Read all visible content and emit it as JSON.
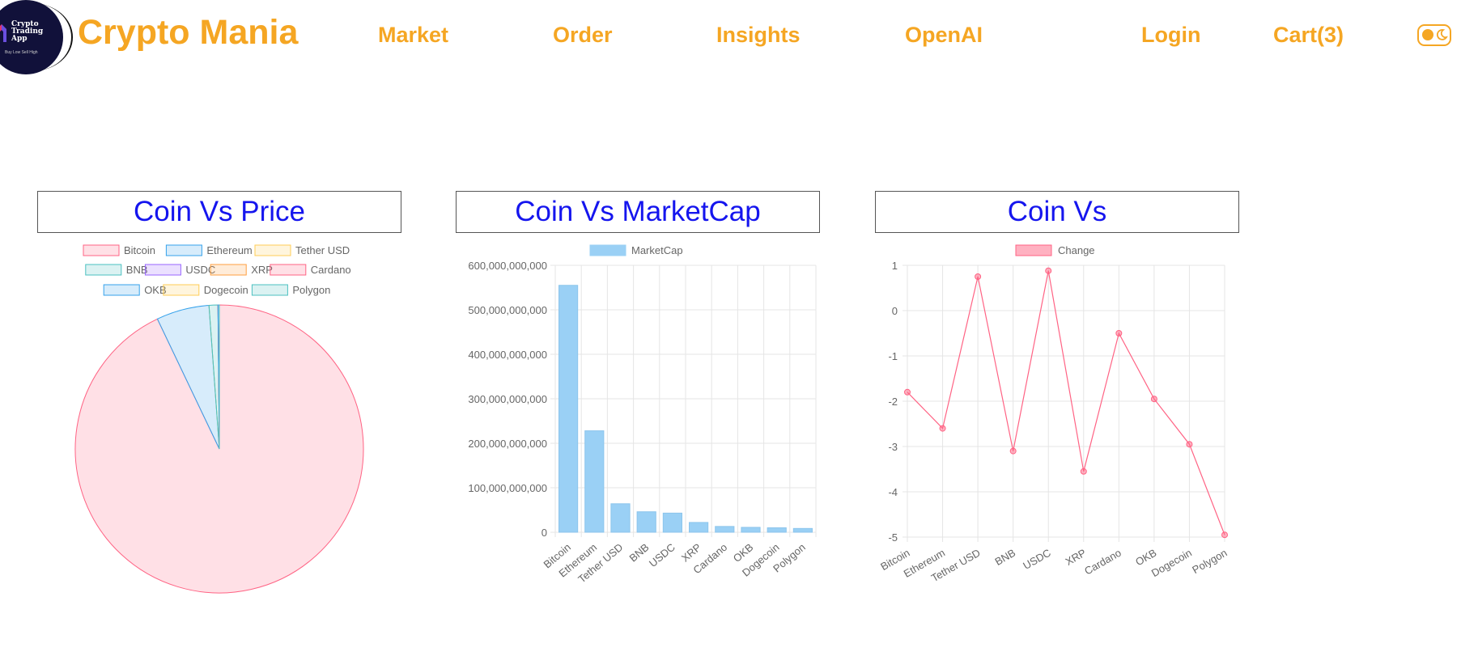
{
  "logo": {
    "line1": "Crypto",
    "line2": "Trading",
    "line3": "App",
    "tagline": "Buy Low Sell High"
  },
  "brand": "Crypto Mania",
  "nav": {
    "market": "Market",
    "order": "Order",
    "insights": "Insights",
    "openai": "OpenAI",
    "login": "Login",
    "cart": "Cart(3)",
    "theme_toggle_icon": "moon-icon"
  },
  "colors": {
    "accent": "#f5a623",
    "title": "#1515ee"
  },
  "titles": {
    "price": "Coin Vs Price",
    "marketcap": "Coin Vs MarketCap",
    "change": "Coin Vs"
  },
  "chart_data": [
    {
      "type": "pie",
      "title": "Coin Vs Price",
      "categories": [
        "Bitcoin",
        "Ethereum",
        "Tether USD",
        "BNB",
        "USDC",
        "XRP",
        "Cardano",
        "OKB",
        "Dogecoin",
        "Polygon"
      ],
      "values": [
        29000,
        1850,
        1,
        310,
        1,
        0.62,
        0.39,
        45,
        0.09,
        0.8
      ],
      "legend": "top",
      "colors": [
        "#ff6384",
        "#36a2eb",
        "#ffcd56",
        "#4bc0c0",
        "#9966ff",
        "#ff9f40",
        "#ff6384",
        "#36a2eb",
        "#ffcd56",
        "#4bc0c0"
      ]
    },
    {
      "type": "bar",
      "title": "Coin Vs MarketCap",
      "categories": [
        "Bitcoin",
        "Ethereum",
        "Tether USD",
        "BNB",
        "USDC",
        "XRP",
        "Cardano",
        "OKB",
        "Dogecoin",
        "Polygon"
      ],
      "series": [
        {
          "name": "MarketCap",
          "values": [
            555000000000,
            228000000000,
            64000000000,
            46000000000,
            43000000000,
            22000000000,
            13000000000,
            11000000000,
            10000000000,
            8500000000
          ]
        }
      ],
      "ylim": [
        0,
        600000000000
      ],
      "yticks": [
        "600,000,000,000",
        "500,000,000,000",
        "400,000,000,000",
        "300,000,000,000",
        "200,000,000,000",
        "100,000,000,000",
        "0"
      ],
      "legend": "top",
      "grid": true,
      "color": "#9ad0f5"
    },
    {
      "type": "line",
      "title": "Coin Vs",
      "categories": [
        "Bitcoin",
        "Ethereum",
        "Tether USD",
        "BNB",
        "USDC",
        "XRP",
        "Cardano",
        "OKB",
        "Dogecoin",
        "Polygon"
      ],
      "series": [
        {
          "name": "Change",
          "values": [
            -1.8,
            -2.6,
            0.75,
            -3.1,
            0.88,
            -3.55,
            -0.5,
            -1.95,
            -2.95,
            -4.95
          ]
        }
      ],
      "ylim": [
        -5,
        1
      ],
      "yticks": [
        "1",
        "0",
        "-1",
        "-2",
        "-3",
        "-4",
        "-5"
      ],
      "legend": "top",
      "grid": true,
      "color": "#ff6384"
    }
  ]
}
